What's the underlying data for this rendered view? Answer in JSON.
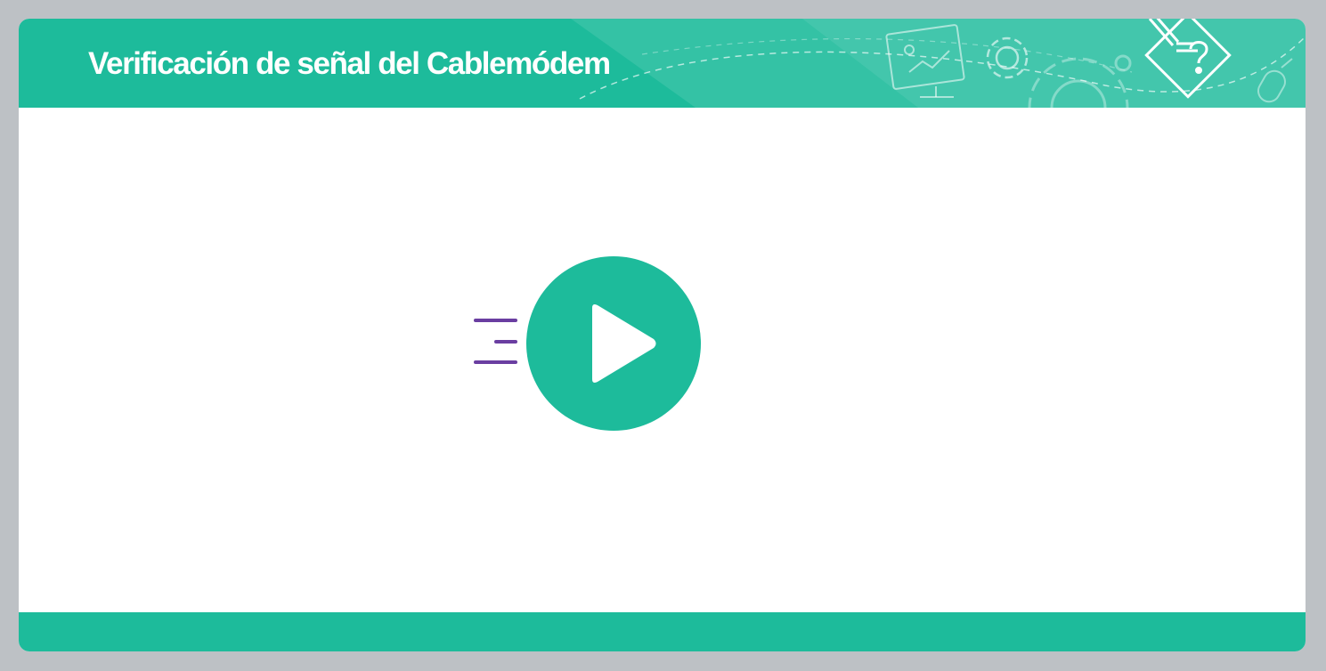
{
  "header": {
    "title": "Verificación de señal del Cablemódem",
    "decorations": [
      "presentation-board-icon",
      "gear-icon",
      "large-gear-icon",
      "mouse-icon",
      "troubleshoot-document-icon"
    ]
  },
  "player": {
    "play_icon": "play-icon",
    "speed_lines_icon": "speed-lines-icon"
  },
  "colors": {
    "brand_green": "#1dbb9b",
    "accent_purple": "#6a3ea1",
    "background_gray": "#bdc1c5",
    "surface_white": "#ffffff"
  }
}
